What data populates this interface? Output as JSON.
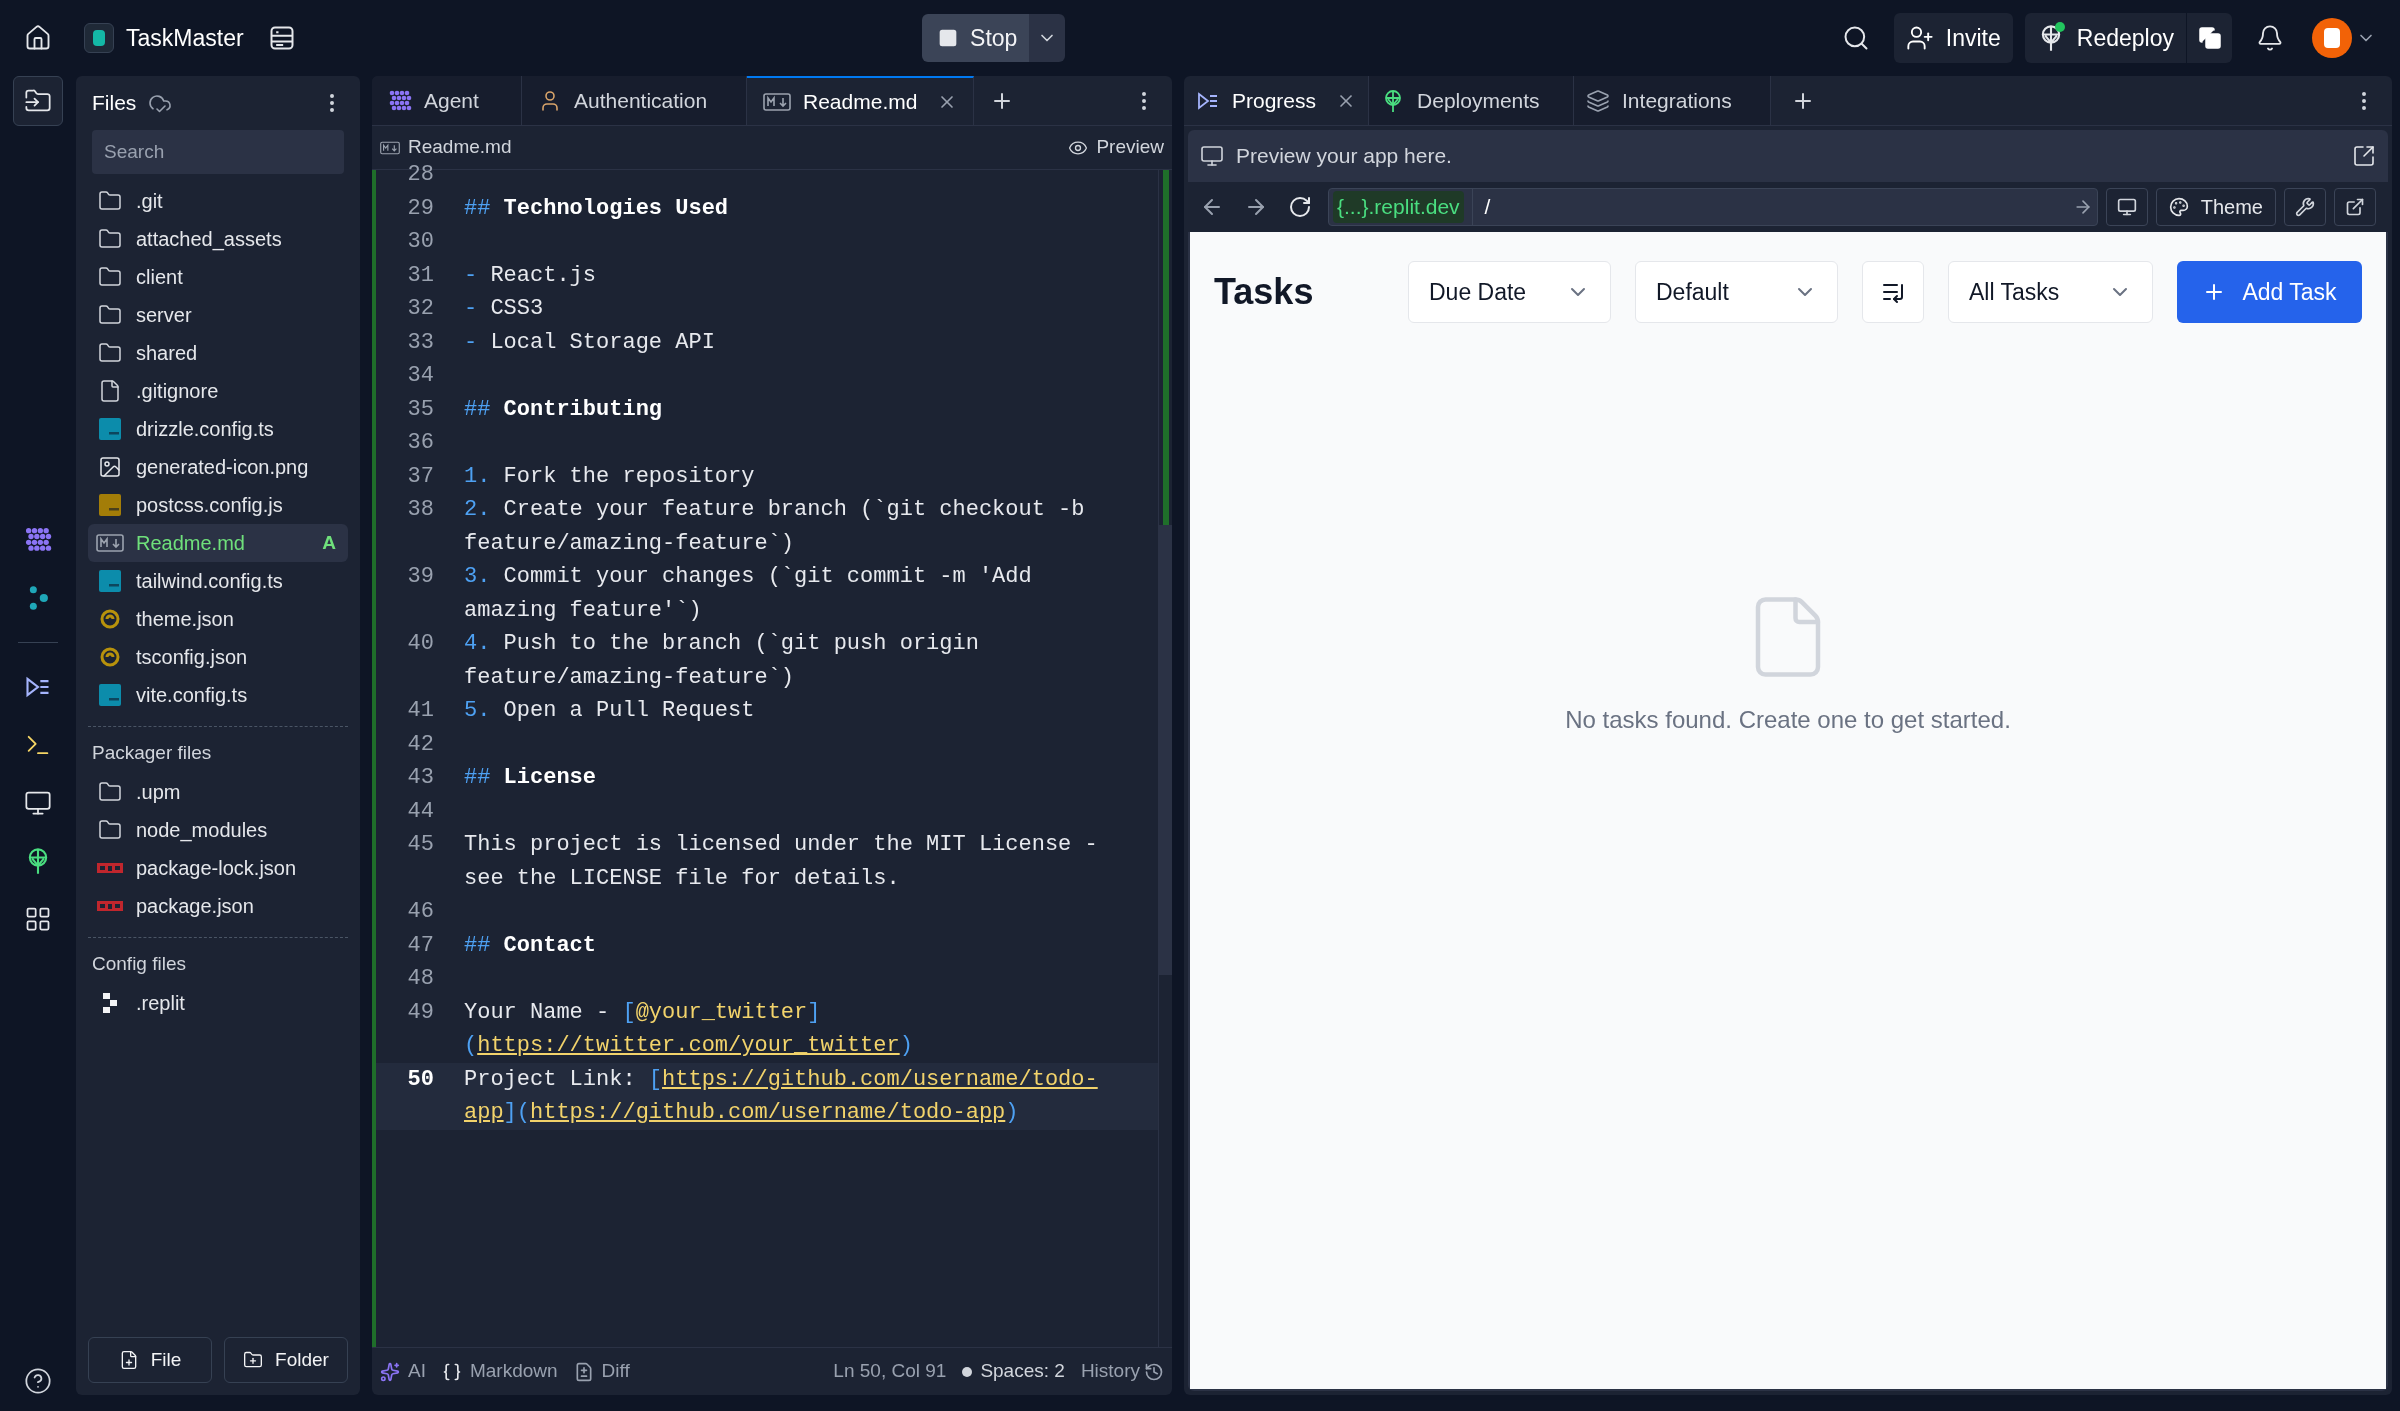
{
  "topbar": {
    "project": "TaskMaster",
    "stop": "Stop",
    "invite": "Invite",
    "redeploy": "Redeploy"
  },
  "files": {
    "title": "Files",
    "search_placeholder": "Search",
    "items": [
      {
        "name": ".git",
        "kind": "folder",
        "selected": false
      },
      {
        "name": "attached_assets",
        "kind": "folder",
        "selected": false
      },
      {
        "name": "client",
        "kind": "folder",
        "selected": false
      },
      {
        "name": "server",
        "kind": "folder",
        "selected": false
      },
      {
        "name": "shared",
        "kind": "folder",
        "selected": false
      },
      {
        "name": ".gitignore",
        "kind": "file",
        "selected": false
      },
      {
        "name": "drizzle.config.ts",
        "kind": "ts",
        "selected": false
      },
      {
        "name": "generated-icon.png",
        "kind": "image",
        "selected": false
      },
      {
        "name": "postcss.config.js",
        "kind": "js",
        "selected": false
      },
      {
        "name": "Readme.md",
        "kind": "md",
        "selected": true,
        "badge": "A"
      },
      {
        "name": "tailwind.config.ts",
        "kind": "ts",
        "selected": false
      },
      {
        "name": "theme.json",
        "kind": "json",
        "selected": false
      },
      {
        "name": "tsconfig.json",
        "kind": "json",
        "selected": false
      },
      {
        "name": "vite.config.ts",
        "kind": "ts",
        "selected": false
      }
    ],
    "sections": [
      {
        "title": "Packager files",
        "items": [
          {
            "name": ".upm",
            "kind": "folder"
          },
          {
            "name": "node_modules",
            "kind": "folder"
          },
          {
            "name": "package-lock.json",
            "kind": "npm"
          },
          {
            "name": "package.json",
            "kind": "npm"
          }
        ]
      },
      {
        "title": "Config files",
        "items": [
          {
            "name": ".replit",
            "kind": "replit"
          }
        ]
      }
    ],
    "buttons": [
      "File",
      "Folder"
    ]
  },
  "editor": {
    "tabs": [
      {
        "label": "Agent",
        "kind": "agent",
        "selected": false
      },
      {
        "label": "Authentication",
        "kind": "user",
        "selected": false
      },
      {
        "label": "Readme.md",
        "kind": "md",
        "selected": true
      }
    ],
    "breadcrumb": "Readme.md",
    "preview": "Preview",
    "lines": [
      {
        "number": "28",
        "current": false
      },
      {
        "number": "29",
        "current": false,
        "tokens": [
          {
            "kind": "mark",
            "text": "##"
          },
          {
            "kind": "heading",
            "text": " Technologies Used"
          }
        ]
      },
      {
        "number": "30",
        "current": false
      },
      {
        "number": "31",
        "current": false,
        "tokens": [
          {
            "kind": "mark",
            "text": "-"
          },
          {
            "kind": "text",
            "text": " React.js"
          }
        ]
      },
      {
        "number": "32",
        "current": false,
        "tokens": [
          {
            "kind": "mark",
            "text": "-"
          },
          {
            "kind": "text",
            "text": " CSS3"
          }
        ]
      },
      {
        "number": "33",
        "current": false,
        "tokens": [
          {
            "kind": "mark",
            "text": "-"
          },
          {
            "kind": "text",
            "text": " Local Storage API"
          }
        ]
      },
      {
        "number": "34",
        "current": false
      },
      {
        "number": "35",
        "current": false,
        "tokens": [
          {
            "kind": "mark",
            "text": "##"
          },
          {
            "kind": "heading",
            "text": " Contributing"
          }
        ]
      },
      {
        "number": "36",
        "current": false
      },
      {
        "number": "37",
        "current": false,
        "tokens": [
          {
            "kind": "mark",
            "text": "1."
          },
          {
            "kind": "text",
            "text": " Fork the repository"
          }
        ]
      },
      {
        "number": "38",
        "current": false,
        "tokens": [
          {
            "kind": "mark",
            "text": "2."
          },
          {
            "kind": "text",
            "text": " Create your feature branch (`git checkout -b feature/amazing-feature`)"
          }
        ]
      },
      {
        "number": "39",
        "current": false,
        "tokens": [
          {
            "kind": "mark",
            "text": "3."
          },
          {
            "kind": "text",
            "text": " Commit your changes (`git commit -m 'Add amazing feature'`)"
          }
        ]
      },
      {
        "number": "40",
        "current": false,
        "tokens": [
          {
            "kind": "mark",
            "text": "4."
          },
          {
            "kind": "text",
            "text": " Push to the branch (`git push origin feature/amazing-feature`)"
          }
        ]
      },
      {
        "number": "41",
        "current": false,
        "tokens": [
          {
            "kind": "mark",
            "text": "5."
          },
          {
            "kind": "text",
            "text": " Open a Pull Request"
          }
        ]
      },
      {
        "number": "42",
        "current": false
      },
      {
        "number": "43",
        "current": false,
        "tokens": [
          {
            "kind": "mark",
            "text": "##"
          },
          {
            "kind": "heading",
            "text": " License"
          }
        ]
      },
      {
        "number": "44",
        "current": false
      },
      {
        "number": "45",
        "current": false,
        "tokens": [
          {
            "kind": "text",
            "text": "This project is licensed under the MIT License - see the LICENSE file for details."
          }
        ]
      },
      {
        "number": "46",
        "current": false
      },
      {
        "number": "47",
        "current": false,
        "tokens": [
          {
            "kind": "mark",
            "text": "##"
          },
          {
            "kind": "heading",
            "text": " Contact"
          }
        ]
      },
      {
        "number": "48",
        "current": false
      },
      {
        "number": "49",
        "current": false,
        "tokens": [
          {
            "kind": "text",
            "text": "Your Name - "
          },
          {
            "kind": "mark",
            "text": "["
          },
          {
            "kind": "label",
            "text": "@your_twitter"
          },
          {
            "kind": "mark",
            "text": "]"
          },
          {
            "kind": "mark",
            "text": "("
          },
          {
            "kind": "url",
            "text": "https://twitter.com/your_twitter"
          },
          {
            "kind": "mark",
            "text": ")"
          }
        ]
      },
      {
        "number": "50",
        "current": true,
        "tokens": [
          {
            "kind": "text",
            "text": "Project Link: "
          },
          {
            "kind": "mark",
            "text": "["
          },
          {
            "kind": "url",
            "text": "https://github.com/username/todo-app"
          },
          {
            "kind": "mark",
            "text": "]"
          },
          {
            "kind": "mark",
            "text": "("
          },
          {
            "kind": "url",
            "text": "https://github.com/username/todo-app"
          },
          {
            "kind": "mark",
            "text": ")"
          }
        ]
      }
    ],
    "status": {
      "ai": "AI",
      "language": "Markdown",
      "diff": "Diff",
      "position": "Ln 50, Col 91",
      "spaces": "Spaces: 2",
      "history": "History"
    }
  },
  "right": {
    "tabs": [
      {
        "label": "Progress",
        "kind": "progress",
        "selected": true
      },
      {
        "label": "Deployments",
        "kind": "deploy",
        "selected": false
      },
      {
        "label": "Integrations",
        "kind": "layers",
        "selected": false
      }
    ],
    "preview_hint": "Preview your app here.",
    "domain": "{...}.replit.dev",
    "path": "/",
    "theme": "Theme",
    "app": {
      "title": "Tasks",
      "selects": [
        "Due Date",
        "Default"
      ],
      "filter": "All Tasks",
      "add": "Add Task",
      "empty": "No tasks found. Create one to get started."
    }
  }
}
